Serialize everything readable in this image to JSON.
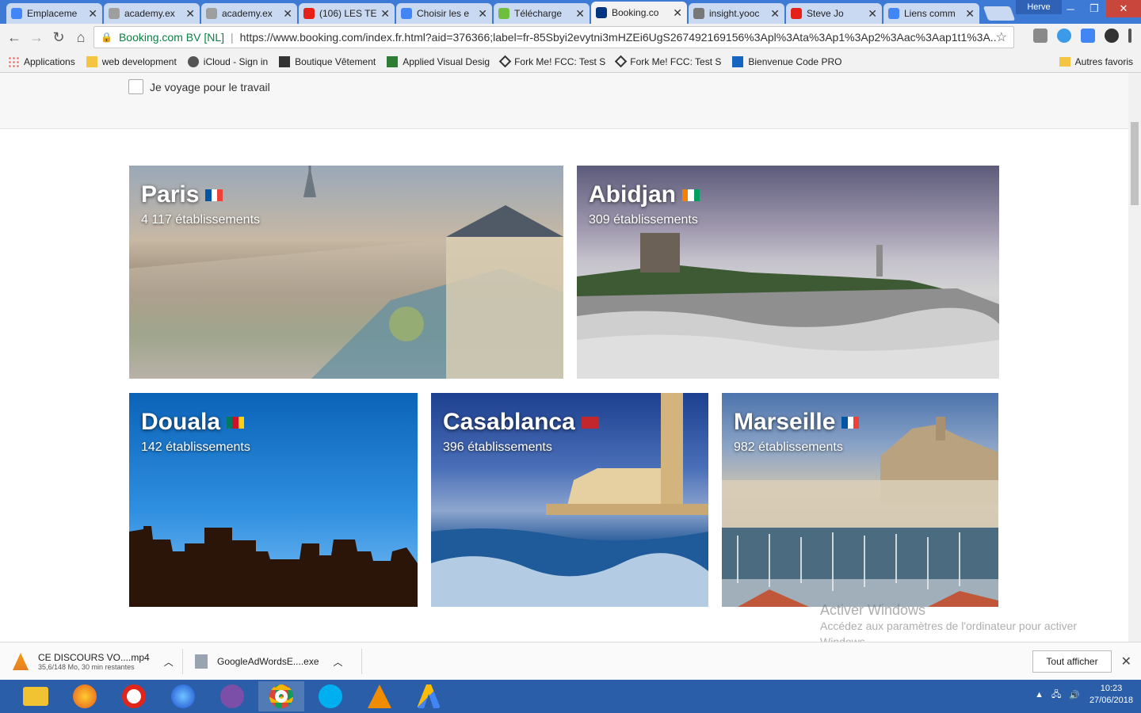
{
  "browser": {
    "tabs": [
      {
        "label": "Emplaceme",
        "icon_color": "#4285f4"
      },
      {
        "label": "academy.ex",
        "icon_color": "#9e9e9e"
      },
      {
        "label": "academy.ex",
        "icon_color": "#9e9e9e"
      },
      {
        "label": "(106) LES TE",
        "icon_color": "#e62117"
      },
      {
        "label": "Choisir les e",
        "icon_color": "#4285f4"
      },
      {
        "label": "Télécharge",
        "icon_color": "#6fbf3e"
      },
      {
        "label": "Booking.co",
        "icon_color": "#003580",
        "active": true
      },
      {
        "label": "insight.yooc",
        "icon_color": "#777777"
      },
      {
        "label": "Steve Jo",
        "icon_color": "#e62117"
      },
      {
        "label": "Liens comm",
        "icon_color": "#4285f4"
      }
    ],
    "user_name": "Herve",
    "address": {
      "site": "Booking.com BV [NL]",
      "url": "https://www.booking.com/index.fr.html?aid=376366;label=fr-85Sbyi2evytni3mHZEi6UgS267492169156%3Apl%3Ata%3Ap1%3Ap2%3Aac%3Aap1t1%3A..."
    },
    "bookmarks": [
      {
        "label": "Applications",
        "icon_color": "#e74c3c"
      },
      {
        "label": "web development",
        "icon_color": "#f4c542"
      },
      {
        "label": "iCloud - Sign in",
        "icon_color": "#555555"
      },
      {
        "label": "Boutique Vêtement",
        "icon_color": "#333333"
      },
      {
        "label": "Applied Visual Desig",
        "icon_color": "#2e7d32"
      },
      {
        "label": "Fork Me! FCC: Test S",
        "icon_color": "#333333"
      },
      {
        "label": "Fork Me! FCC: Test S",
        "icon_color": "#333333"
      },
      {
        "label": "Bienvenue Code PRO",
        "icon_color": "#1565c0"
      }
    ],
    "other_bookmarks": "Autres favoris"
  },
  "page": {
    "business_checkbox_label": "Je voyage pour le travail",
    "destinations": [
      {
        "city": "Paris",
        "count": "4 117 établissements",
        "flag": [
          "#0055a4",
          "#ffffff",
          "#ef4135"
        ]
      },
      {
        "city": "Abidjan",
        "count": "309 établissements",
        "flag": [
          "#f77f00",
          "#ffffff",
          "#009e60"
        ]
      },
      {
        "city": "Douala",
        "count": "142 établissements",
        "flag": [
          "#007a5e",
          "#ce1126",
          "#fcd116"
        ]
      },
      {
        "city": "Casablanca",
        "count": "396 établissements",
        "flag": [
          "#c1272d",
          "#c1272d",
          "#c1272d"
        ]
      },
      {
        "city": "Marseille",
        "count": "982 établissements",
        "flag": [
          "#0055a4",
          "#ffffff",
          "#ef4135"
        ]
      }
    ]
  },
  "watermark": {
    "title": "Activer Windows",
    "text": "Accédez aux paramètres de l'ordinateur pour activer Windows."
  },
  "downloads": {
    "items": [
      {
        "name": "CE DISCOURS VO....mp4",
        "status": "35,6/148 Mo, 30 min restantes"
      },
      {
        "name": "GoogleAdWordsE....exe",
        "status": ""
      }
    ],
    "show_all": "Tout afficher"
  },
  "taskbar": {
    "time": "10:23",
    "date": "27/06/2018"
  }
}
